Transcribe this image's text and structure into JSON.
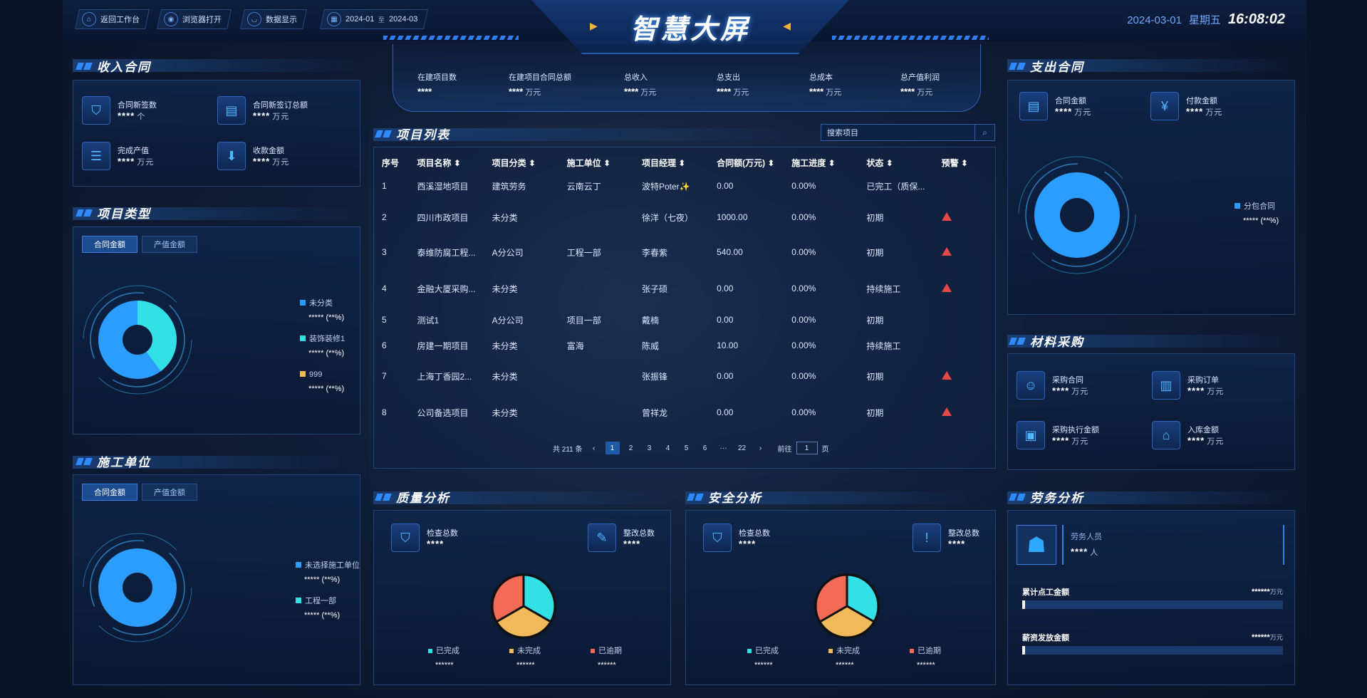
{
  "header": {
    "back_label": "返回工作台",
    "browser_label": "浏览器打开",
    "display_label": "数据显示",
    "date_from": "2024-01",
    "date_sep": "至",
    "date_to": "2024-03",
    "title": "智慧大屏",
    "date": "2024-03-01",
    "weekday": "星期五",
    "time": "16:08:02"
  },
  "income": {
    "title": "收入合同",
    "items": [
      {
        "label": "合同新签数",
        "value": "****",
        "unit": "个",
        "icon": "shield-icon"
      },
      {
        "label": "合同新签订总额",
        "value": "****",
        "unit": "万元",
        "icon": "document-icon"
      },
      {
        "label": "完成产值",
        "value": "****",
        "unit": "万元",
        "icon": "database-icon"
      },
      {
        "label": "收款金额",
        "value": "****",
        "unit": "万元",
        "icon": "download-icon"
      }
    ]
  },
  "project_type": {
    "title": "项目类型",
    "tabs": [
      "合同金额",
      "产值金额"
    ],
    "legend": [
      {
        "name": "未分类",
        "value": "*****",
        "pct": "(**%)",
        "color": "#2b9dff"
      },
      {
        "name": "装饰装修1",
        "value": "*****",
        "pct": "(**%)",
        "color": "#33e0e6"
      },
      {
        "name": "999",
        "value": "*****",
        "pct": "(**%)",
        "color": "#f0b95a"
      }
    ]
  },
  "construction_unit": {
    "title": "施工单位",
    "tabs": [
      "合同金额",
      "产值金额"
    ],
    "legend": [
      {
        "name": "未选择施工单位",
        "value": "*****",
        "pct": "(**%)",
        "color": "#2b9dff"
      },
      {
        "name": "工程一部",
        "value": "*****",
        "pct": "(**%)",
        "color": "#33e0e6"
      }
    ]
  },
  "stats": [
    {
      "label": "在建项目数",
      "value": "****",
      "unit": ""
    },
    {
      "label": "在建项目合同总额",
      "value": "****",
      "unit": "万元"
    },
    {
      "label": "总收入",
      "value": "****",
      "unit": "万元"
    },
    {
      "label": "总支出",
      "value": "****",
      "unit": "万元"
    },
    {
      "label": "总成本",
      "value": "****",
      "unit": "万元"
    },
    {
      "label": "总产值利润",
      "value": "****",
      "unit": "万元"
    }
  ],
  "project_list": {
    "title": "项目列表",
    "search_placeholder": "搜索项目",
    "columns": [
      "序号",
      "项目名称 ⬍",
      "项目分类 ⬍",
      "施工单位 ⬍",
      "项目经理 ⬍",
      "合同额(万元) ⬍",
      "施工进度 ⬍",
      "状态 ⬍",
      "预警 ⬍"
    ],
    "rows": [
      {
        "no": "1",
        "name": "西溪湿地项目",
        "cat": "建筑劳务",
        "unit": "云南云丁",
        "mgr": "波特Poter✨",
        "amount": "0.00",
        "progress": "0.00%",
        "status": "已完工（质保...",
        "warn": false
      },
      {
        "no": "2",
        "name": "四川市政项目",
        "cat": "未分类",
        "unit": "",
        "mgr": "徐洋（七夜）",
        "amount": "1000.00",
        "progress": "0.00%",
        "status": "初期",
        "warn": true
      },
      {
        "no": "3",
        "name": "泰维防腐工程...",
        "cat": "A分公司",
        "unit": "工程一部",
        "mgr": "李春紫",
        "amount": "540.00",
        "progress": "0.00%",
        "status": "初期",
        "warn": true
      },
      {
        "no": "4",
        "name": "金融大厦采购...",
        "cat": "未分类",
        "unit": "",
        "mgr": "张子硕",
        "amount": "0.00",
        "progress": "0.00%",
        "status": "持续施工",
        "warn": true
      },
      {
        "no": "5",
        "name": "测试1",
        "cat": "A分公司",
        "unit": "项目一部",
        "mgr": "戴楠",
        "amount": "0.00",
        "progress": "0.00%",
        "status": "初期",
        "warn": false
      },
      {
        "no": "6",
        "name": "房建一期项目",
        "cat": "未分类",
        "unit": "富海",
        "mgr": "陈威",
        "amount": "10.00",
        "progress": "0.00%",
        "status": "持续施工",
        "warn": false
      },
      {
        "no": "7",
        "name": "上海丁香园2...",
        "cat": "未分类",
        "unit": "",
        "mgr": "张振锋",
        "amount": "0.00",
        "progress": "0.00%",
        "status": "初期",
        "warn": true
      },
      {
        "no": "8",
        "name": "公司备选项目",
        "cat": "未分类",
        "unit": "",
        "mgr": "曾祥龙",
        "amount": "0.00",
        "progress": "0.00%",
        "status": "初期",
        "warn": true
      }
    ],
    "pager": {
      "total": "共 211 条",
      "prev": "‹",
      "pages": [
        "1",
        "2",
        "3",
        "4",
        "5",
        "6",
        "···",
        "22"
      ],
      "next": "›",
      "goto": "前往",
      "page_input": "1",
      "page_suffix": "页"
    }
  },
  "quality": {
    "title": "质量分析",
    "check_label": "检查总数",
    "check_value": "****",
    "fix_label": "整改总数",
    "fix_value": "****",
    "legend": [
      {
        "name": "已完成",
        "value": "******",
        "color": "#33e0e6"
      },
      {
        "name": "未完成",
        "value": "******",
        "color": "#f0b95a"
      },
      {
        "name": "已逾期",
        "value": "******",
        "color": "#f26b57"
      }
    ]
  },
  "safety": {
    "title": "安全分析",
    "check_label": "检查总数",
    "check_value": "****",
    "fix_label": "整改总数",
    "fix_value": "****",
    "legend": [
      {
        "name": "已完成",
        "value": "******",
        "color": "#33e0e6"
      },
      {
        "name": "未完成",
        "value": "******",
        "color": "#f0b95a"
      },
      {
        "name": "已逾期",
        "value": "******",
        "color": "#f26b57"
      }
    ]
  },
  "expense": {
    "title": "支出合同",
    "items": [
      {
        "label": "合同金额",
        "value": "****",
        "unit": "万元",
        "icon": "document-icon"
      },
      {
        "label": "付款金额",
        "value": "****",
        "unit": "万元",
        "icon": "payment-icon"
      }
    ],
    "legend": [
      {
        "name": "分包合同",
        "value": "*****",
        "pct": "(**%)",
        "color": "#2b9dff"
      }
    ]
  },
  "material": {
    "title": "材料采购",
    "items": [
      {
        "label": "采购合同",
        "value": "****",
        "unit": "万元",
        "icon": "user-icon"
      },
      {
        "label": "采购订单",
        "value": "****",
        "unit": "万元",
        "icon": "clipboard-icon"
      },
      {
        "label": "采购执行金额",
        "value": "****",
        "unit": "万元",
        "icon": "bag-icon"
      },
      {
        "label": "入库金额",
        "value": "****",
        "unit": "万元",
        "icon": "warehouse-icon"
      }
    ]
  },
  "labor": {
    "title": "劳务分析",
    "staff_label": "劳务人员",
    "staff_value": "****",
    "staff_unit": "人",
    "bars": [
      {
        "label": "累计点工金额",
        "value": "******",
        "unit": "万元"
      },
      {
        "label": "薪资发放金额",
        "value": "******",
        "unit": "万元"
      }
    ]
  },
  "colors": {
    "accent": "#2e8bff",
    "cyan": "#33e0e6",
    "yellow": "#f0b95a",
    "red": "#f26b57",
    "warn": "#e64848"
  }
}
